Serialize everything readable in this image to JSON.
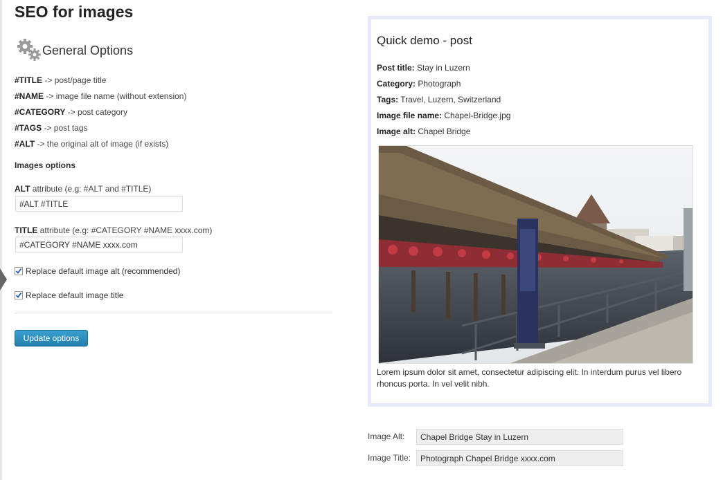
{
  "page": {
    "title": "SEO for images"
  },
  "general": {
    "section_title": "General Options",
    "icon": "gears-icon",
    "legend": [
      {
        "token": "#TITLE",
        "desc": " -> post/page title"
      },
      {
        "token": "#NAME",
        "desc": " -> image file name (without extension)"
      },
      {
        "token": "#CATEGORY",
        "desc": " -> post category"
      },
      {
        "token": "#TAGS",
        "desc": " -> post tags"
      },
      {
        "token": "#ALT",
        "desc": " -> the original alt of image (if exists)"
      }
    ]
  },
  "images_options": {
    "heading": "Images options",
    "alt_label_bold": "ALT",
    "alt_label_rest": " attribute (e.g: #ALT and #TITLE)",
    "alt_value": "#ALT #TITLE",
    "title_label_bold": "TITLE",
    "title_label_rest": " attribute (e.g: #CATEGORY #NAME xxxx.com)",
    "title_value": "#CATEGORY #NAME xxxx.com",
    "replace_alt_label": "Replace default image alt (recommended)",
    "replace_alt_checked": true,
    "replace_title_label": "Replace default image title",
    "replace_title_checked": true,
    "update_button": "Update options"
  },
  "demo": {
    "title": "Quick demo - post",
    "meta": [
      {
        "label": "Post title:",
        "value": " Stay in Luzern"
      },
      {
        "label": "Category:",
        "value": " Photograph"
      },
      {
        "label": "Tags:",
        "value": " Travel, Luzern, Switzerland"
      },
      {
        "label": "Image file name:",
        "value": " Chapel-Bridge.jpg"
      },
      {
        "label": "Image alt:",
        "value": " Chapel Bridge"
      }
    ],
    "caption": "Lorem ipsum dolor sit amet, consectetur adipiscing elit. In interdum purus vel libero rhoncus porta. In vel velit nibh."
  },
  "result": {
    "alt_label": "Image Alt:",
    "alt_value": "Chapel Bridge Stay in Luzern",
    "title_label": "Image Title:",
    "title_value": "Photograph Chapel Bridge xxxx.com"
  },
  "colors": {
    "button": "#2a8ab8",
    "demo_border": "#e6e9fb"
  }
}
